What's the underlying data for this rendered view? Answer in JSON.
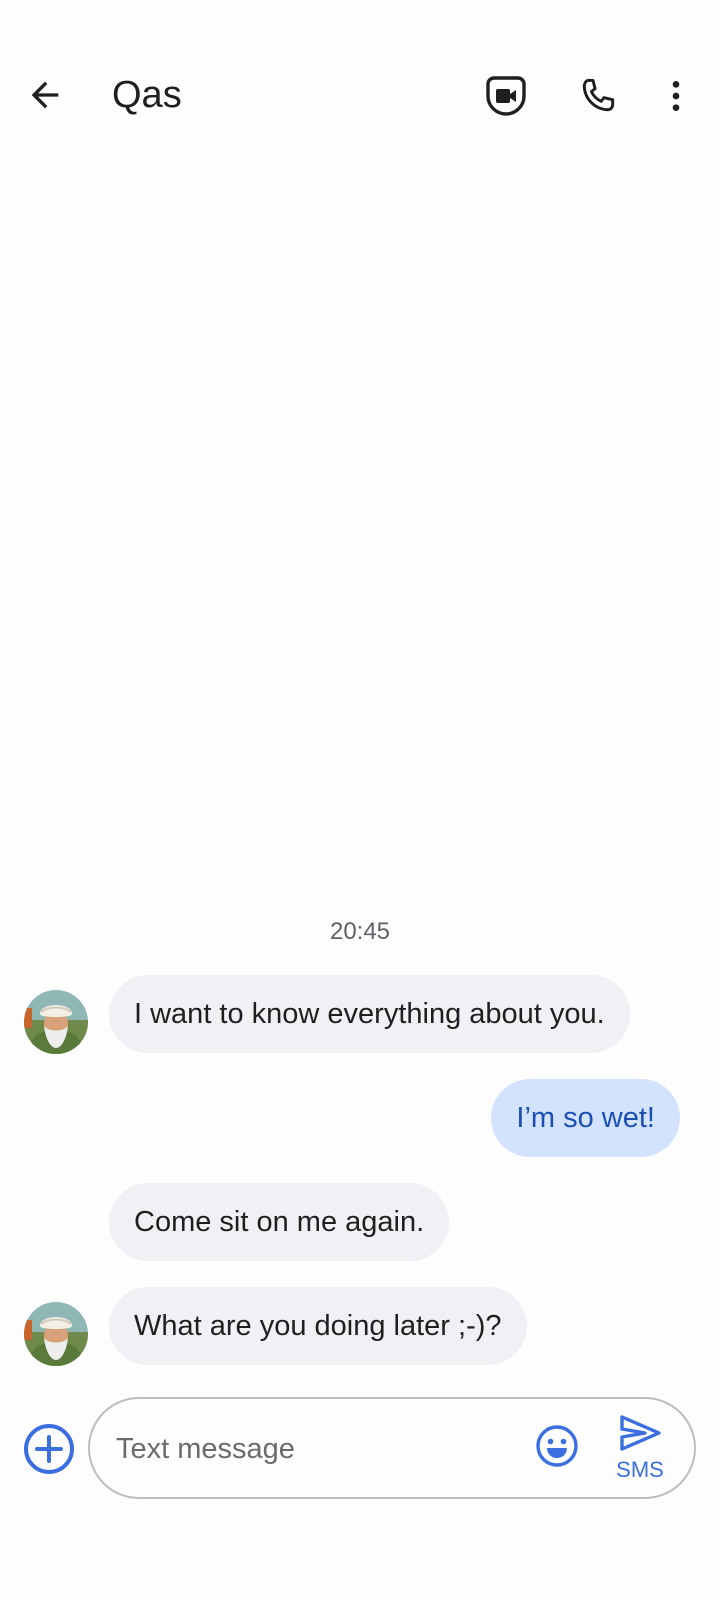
{
  "header": {
    "contact_name": "Qas"
  },
  "conversation": {
    "timestamp": "20:45",
    "messages": [
      {
        "direction": "in",
        "text": "I want to know everything about you."
      },
      {
        "direction": "out",
        "text": "I’m so wet!"
      },
      {
        "direction": "in",
        "text": "Come sit on me again."
      },
      {
        "direction": "in",
        "text": "What are you doing later ;-)?"
      }
    ]
  },
  "composer": {
    "placeholder": "Text message",
    "value": "",
    "send_label": "SMS"
  },
  "icons": {
    "back": "arrow-back-icon",
    "video": "video-call-icon",
    "call": "phone-icon",
    "more": "more-vert-icon",
    "add": "add-circle-icon",
    "emoji": "emoji-icon",
    "send": "send-icon"
  },
  "colors": {
    "incoming_bubble": "#f0f1f4",
    "outgoing_bubble": "#d3e3fd",
    "outgoing_text": "#1a4fb3",
    "accent": "#3b6fe0"
  }
}
